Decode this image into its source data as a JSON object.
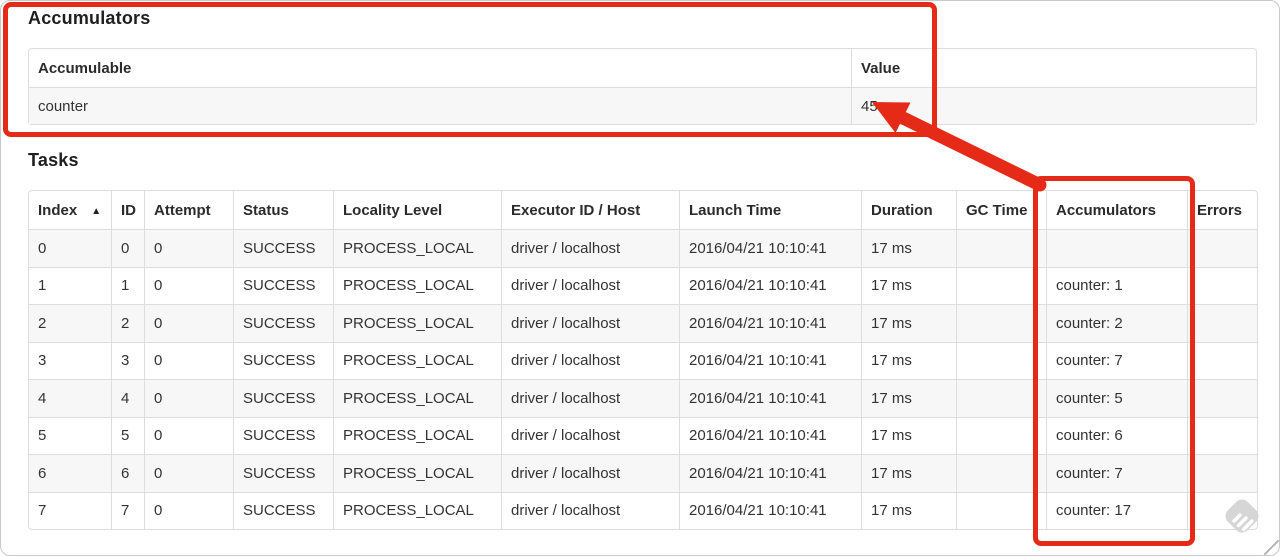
{
  "accumulators_section": {
    "title": "Accumulators",
    "table": {
      "headers": [
        "Accumulable",
        "Value"
      ],
      "rows": [
        [
          "counter",
          "45"
        ]
      ]
    }
  },
  "tasks_section": {
    "title": "Tasks",
    "table": {
      "headers": [
        "Index",
        "ID",
        "Attempt",
        "Status",
        "Locality Level",
        "Executor ID / Host",
        "Launch Time",
        "Duration",
        "GC Time",
        "Accumulators",
        "Errors"
      ],
      "sort_indicator": "▲",
      "rows": [
        [
          "0",
          "0",
          "0",
          "SUCCESS",
          "PROCESS_LOCAL",
          "driver / localhost",
          "2016/04/21 10:10:41",
          "17 ms",
          "",
          "",
          ""
        ],
        [
          "1",
          "1",
          "0",
          "SUCCESS",
          "PROCESS_LOCAL",
          "driver / localhost",
          "2016/04/21 10:10:41",
          "17 ms",
          "",
          "counter: 1",
          ""
        ],
        [
          "2",
          "2",
          "0",
          "SUCCESS",
          "PROCESS_LOCAL",
          "driver / localhost",
          "2016/04/21 10:10:41",
          "17 ms",
          "",
          "counter: 2",
          ""
        ],
        [
          "3",
          "3",
          "0",
          "SUCCESS",
          "PROCESS_LOCAL",
          "driver / localhost",
          "2016/04/21 10:10:41",
          "17 ms",
          "",
          "counter: 7",
          ""
        ],
        [
          "4",
          "4",
          "0",
          "SUCCESS",
          "PROCESS_LOCAL",
          "driver / localhost",
          "2016/04/21 10:10:41",
          "17 ms",
          "",
          "counter: 5",
          ""
        ],
        [
          "5",
          "5",
          "0",
          "SUCCESS",
          "PROCESS_LOCAL",
          "driver / localhost",
          "2016/04/21 10:10:41",
          "17 ms",
          "",
          "counter: 6",
          ""
        ],
        [
          "6",
          "6",
          "0",
          "SUCCESS",
          "PROCESS_LOCAL",
          "driver / localhost",
          "2016/04/21 10:10:41",
          "17 ms",
          "",
          "counter: 7",
          ""
        ],
        [
          "7",
          "7",
          "0",
          "SUCCESS",
          "PROCESS_LOCAL",
          "driver / localhost",
          "2016/04/21 10:10:41",
          "17 ms",
          "",
          "counter: 17",
          ""
        ]
      ]
    }
  },
  "annotations": {
    "red": "#e52b17",
    "watermark_gray": "#d6d6d6",
    "corner_gray": "#b5b5b5"
  }
}
